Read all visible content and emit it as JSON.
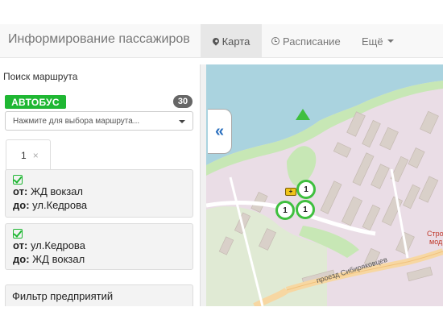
{
  "header": {
    "title": "Информирование пассажиров",
    "nav": {
      "map": "Карта",
      "schedule": "Расписание",
      "more": "Ещё"
    }
  },
  "sidebar": {
    "title": "Поиск маршрута",
    "transport_type": "АВТОБУС",
    "route_count": "30",
    "route_select_placeholder": "Нажмите для выбора маршрута...",
    "tab": {
      "label": "1",
      "close": "×"
    },
    "directions": [
      {
        "from_label": "от:",
        "from": "ЖД вокзал",
        "to_label": "до:",
        "to": "ул.Кедрова"
      },
      {
        "from_label": "от:",
        "from": "ул.Кедрова",
        "to_label": "до:",
        "to": "ЖД вокзал"
      }
    ],
    "filter_title": "Фильтр предприятий"
  },
  "map": {
    "collapse_icon": "«",
    "street_label": "проезд Сибиряковцев",
    "edge_label_1": "Стро",
    "edge_label_2": "мод",
    "markers": [
      "1",
      "1",
      "1"
    ],
    "bus_symbol": "+",
    "colors": {
      "water": "#aad3df",
      "land": "#eadde6",
      "green": "#c7e7b5",
      "road": "#f7d7a2",
      "marker": "#3fbf3f"
    }
  }
}
